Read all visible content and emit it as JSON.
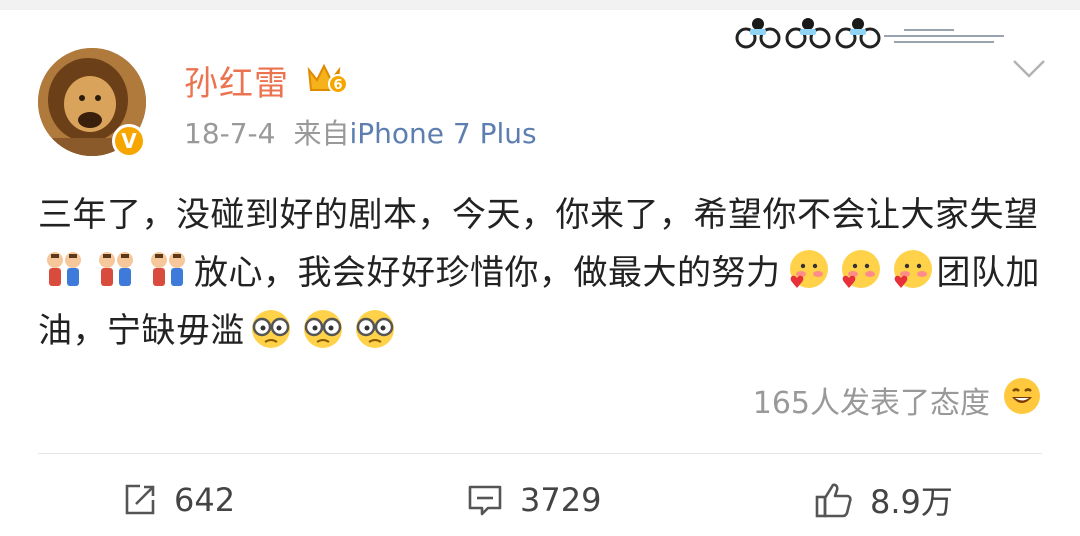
{
  "post": {
    "username": "孙红雷",
    "date": "18-7-4",
    "from_label": "来自",
    "source": "iPhone 7 Plus",
    "verified_mark": "V",
    "level_badge": "6",
    "text": {
      "seg1": "三年了，没碰到好的剧本，今天，你来了，希望你不会让大家失望",
      "seg2": "放心，我会好好珍惜你，做最大的努力",
      "seg3": "团队加油，宁缺毋滥"
    },
    "attitude_text": "165人发表了态度"
  },
  "actions": {
    "repost_count": "642",
    "comment_count": "3729",
    "like_count": "8.9万"
  },
  "icons": {
    "header": [
      "crown-level-icon",
      "chevron-down-icon",
      "bikes-decoration-icon"
    ],
    "emoji_group1": "kids-emoji-icon",
    "emoji_group2": "blush-emoji-icon",
    "emoji_group3": "glasses-emoji-icon",
    "attitude": "smile-icon",
    "actions": [
      "repost-icon",
      "comment-icon",
      "like-icon"
    ]
  },
  "colors": {
    "username": "#eb7350",
    "source_link": "#5d7faf",
    "muted": "#999999",
    "badge": "#f7a600"
  }
}
